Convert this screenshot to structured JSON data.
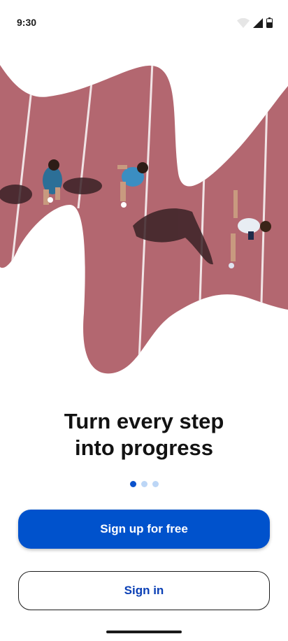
{
  "status_bar": {
    "time": "9:30"
  },
  "hero": {
    "image_name": "runners-on-track-aerial",
    "track_color": "#b86a73"
  },
  "onboarding": {
    "headline_line1": "Turn every step",
    "headline_line2": "into progress",
    "page_indicator": {
      "total": 3,
      "current": 1
    }
  },
  "actions": {
    "signup_label": "Sign up for free",
    "signin_label": "Sign in"
  },
  "colors": {
    "primary": "#0052cc",
    "dot_inactive": "#bcd6f6",
    "text": "#121212"
  }
}
